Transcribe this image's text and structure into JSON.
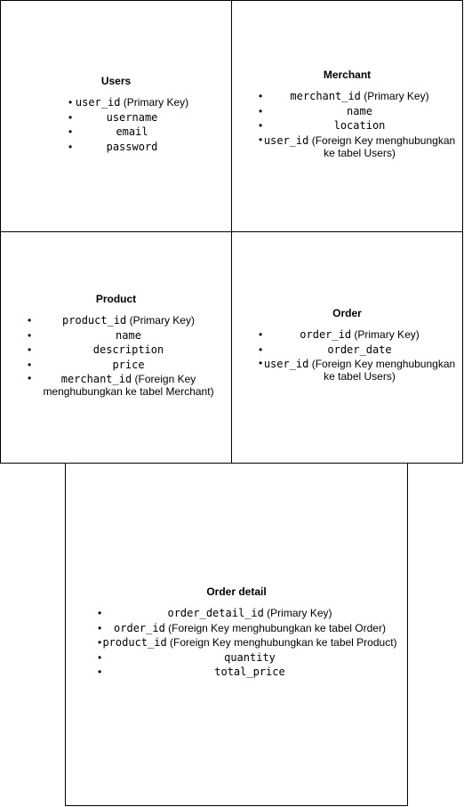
{
  "entities": [
    {
      "title": "Users",
      "fields": [
        {
          "name": "user_id",
          "note": " (Primary Key)"
        },
        {
          "name": "username",
          "note": ""
        },
        {
          "name": "email",
          "note": ""
        },
        {
          "name": "password",
          "note": ""
        }
      ]
    },
    {
      "title": "Merchant",
      "fields": [
        {
          "name": "merchant_id",
          "note": " (Primary Key)"
        },
        {
          "name": "name",
          "note": ""
        },
        {
          "name": "location",
          "note": ""
        },
        {
          "name": "user_id",
          "note": " (Foreign Key menghubungkan",
          "note2": "ke tabel Users)"
        }
      ]
    },
    {
      "title": "Product",
      "fields": [
        {
          "name": "product_id",
          "note": " (Primary Key)"
        },
        {
          "name": "name",
          "note": ""
        },
        {
          "name": "description",
          "note": ""
        },
        {
          "name": "price",
          "note": ""
        },
        {
          "name": "merchant_id",
          "note": " (Foreign Key",
          "note2": "menghubungkan ke tabel Merchant)"
        }
      ]
    },
    {
      "title": "Order",
      "fields": [
        {
          "name": "order_id",
          "note": " (Primary Key)"
        },
        {
          "name": "order_date",
          "note": ""
        },
        {
          "name": "user_id",
          "note": " (Foreign Key menghubungkan",
          "note2": "ke tabel Users)"
        }
      ]
    },
    {
      "title": "Order detail",
      "fields": [
        {
          "name": "order_detail_id",
          "note": " (Primary Key)"
        },
        {
          "name": "order_id",
          "note": " (Foreign Key menghubungkan ke tabel Order)"
        },
        {
          "name": "product_id",
          "note": " (Foreign Key menghubungkan ke tabel Product)"
        },
        {
          "name": "quantity",
          "note": ""
        },
        {
          "name": "total_price",
          "note": ""
        }
      ]
    }
  ]
}
